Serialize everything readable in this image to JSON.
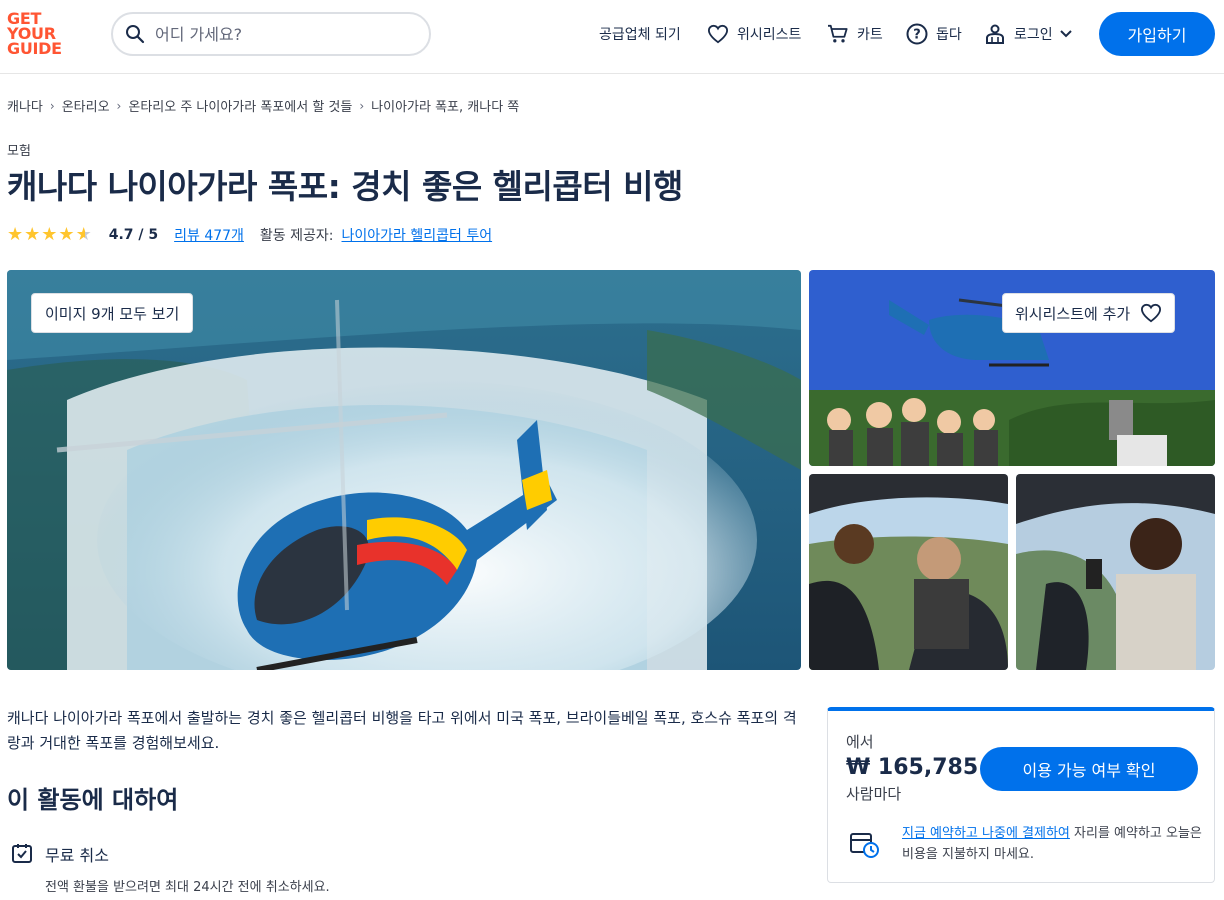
{
  "header": {
    "logo_line1": "GET",
    "logo_line2": "YOUR",
    "logo_line3": "GUIDE",
    "search_placeholder": "어디 가세요?",
    "nav_supplier": "공급업체 되기",
    "nav_wishlist": "위시리스트",
    "nav_cart": "카트",
    "nav_help": "돕다",
    "nav_login": "로그인",
    "signup": "가입하기"
  },
  "breadcrumb": [
    "캐나다",
    "온타리오",
    "온타리오 주 나이아가라 폭포에서 할 것들",
    "나이아가라 폭포, 캐나다 쪽"
  ],
  "activity": {
    "category": "모험",
    "title": "캐나다 나이아가라 폭포: 경치 좋은 헬리콥터 비행",
    "rating": 4.7,
    "rating_text": "4.7 / 5",
    "reviews": "리뷰 477개",
    "provider_label": "활동 제공자:",
    "provider": "나이아가라 헬리콥터 투어"
  },
  "gallery": {
    "view_all": "이미지 9개 모두 보기",
    "add_wishlist": "위시리스트에 추가"
  },
  "description": {
    "intro": "캐나다 나이아가라 폭포에서 출발하는 경치 좋은 헬리콥터 비행을 타고 위에서 미국 폭포, 브라이들베일 폭포, 호스슈 폭포의 격랑과 거대한 폭포를 경험해보세요.",
    "section_title": "이 활동에 대하여",
    "feature_title": "무료 취소",
    "feature_desc": "전액 환불을 받으려면 최대 24시간 전에 취소하세요."
  },
  "booking": {
    "from": "에서",
    "price": "₩ 165,785",
    "per": "사람마다",
    "check": "이용 가능 여부 확인",
    "reserve_link": "지금 예약하고 나중에 결제하여",
    "reserve_rest": " 자리를 예약하고 오늘은 비용을 지불하지 마세요."
  },
  "colors": {
    "brand": "#ff5533",
    "primary": "#0071eb",
    "star": "#ffc52e",
    "text": "#1a2b49"
  }
}
